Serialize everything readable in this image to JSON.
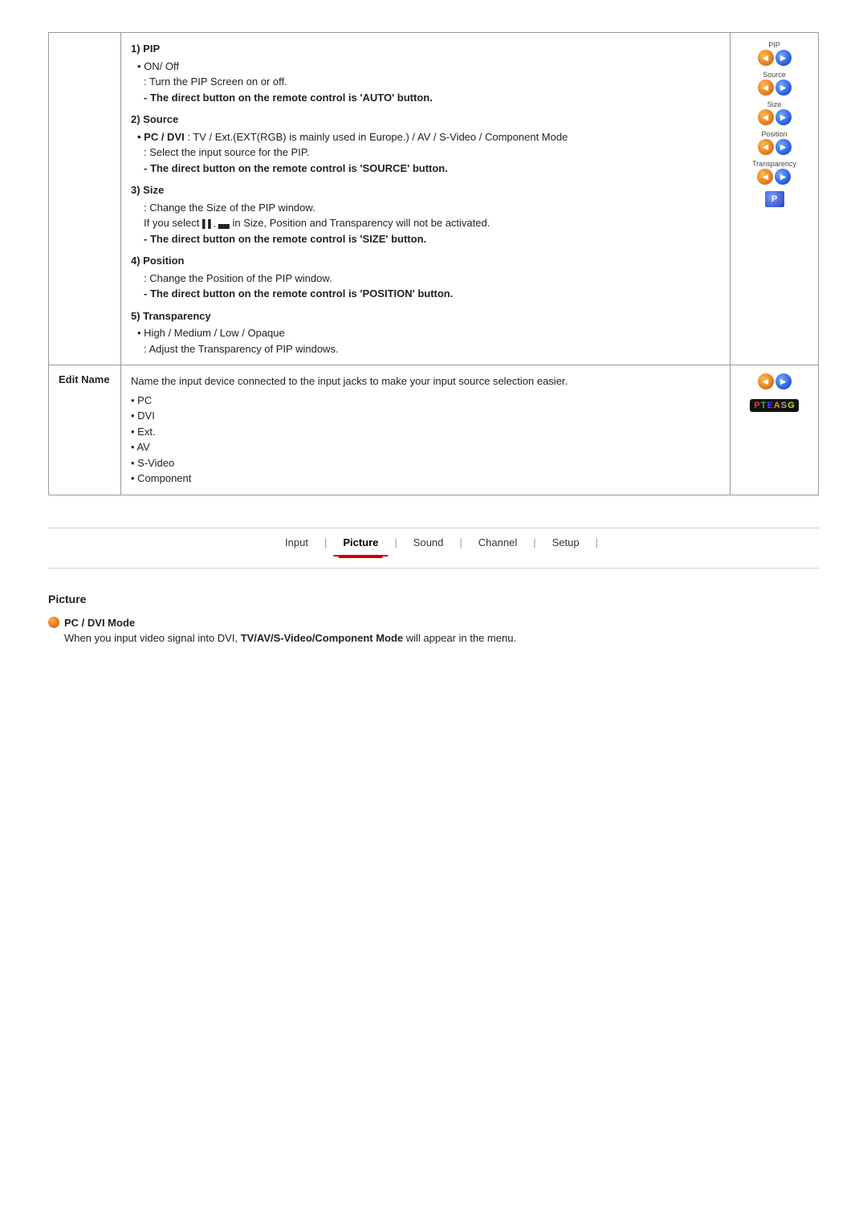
{
  "page": {
    "sections": [
      {
        "label": "",
        "content": {
          "pip_title": "1) PIP",
          "pip_on_off": "• ON/ Off",
          "pip_desc1": ": Turn the PIP Screen on or off.",
          "pip_direct": "- The direct button on the remote control is 'AUTO' button.",
          "source_title": "2) Source",
          "source_pc_dvi": "• PC / DVI",
          "source_pc_dvi_detail": ": TV / Ext.(EXT(RGB) is mainly used in Europe.) / AV / S-Video / Component Mode",
          "source_desc": ": Select the input source for the PIP.",
          "source_direct": "- The direct button on the remote control is 'SOURCE' button.",
          "size_title": "3) Size",
          "size_desc": ": Change the Size of the PIP window.",
          "size_note": "If you select ▌▌, ▄▄ in Size, Position and Transparency will not be activated.",
          "size_direct": "- The direct button on the remote control is 'SIZE' button.",
          "position_title": "4) Position",
          "position_desc": ": Change the Position of the PIP window.",
          "position_direct": "- The direct button on the remote control is 'POSITION' button.",
          "transparency_title": "5) Transparency",
          "transparency_sub": "• High / Medium / Low / Opaque",
          "transparency_desc": ": Adjust the Transparency of PIP windows."
        },
        "right": {
          "pip_label": "PIP",
          "source_label": "Source",
          "size_label": "Size",
          "position_label": "Position",
          "transparency_label": "Transparency",
          "p_label": "P"
        }
      },
      {
        "label": "Edit Name",
        "content": {
          "desc": "Name the input device connected to the input jacks to make your input source selection easier.",
          "items": [
            "• PC",
            "• DVI",
            "• Ext.",
            "• AV",
            "• S-Video",
            "• Component"
          ]
        },
        "right": {
          "pteasg": [
            "P",
            "T",
            "E",
            "A",
            "S",
            "G"
          ],
          "colors": [
            "#ff0000",
            "#33aa33",
            "#3333ff",
            "#ff6600",
            "#8844aa",
            "#cccc00"
          ]
        }
      }
    ],
    "nav": {
      "items": [
        "Input",
        "Picture",
        "Sound",
        "Channel",
        "Setup"
      ],
      "active": "Picture",
      "separators": [
        "|",
        "|",
        "|",
        "|"
      ]
    },
    "picture_section": {
      "heading": "Picture",
      "items": [
        {
          "title": "PC / DVI Mode",
          "desc": "When you input video signal into DVI, TV/AV/S-Video/Component Mode will appear in the menu."
        }
      ]
    }
  }
}
